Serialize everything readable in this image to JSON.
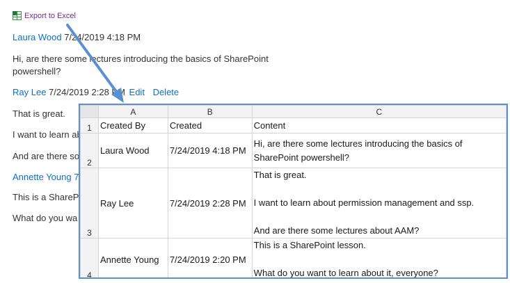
{
  "export_link": {
    "label": "Export to Excel",
    "icon": "excel-icon"
  },
  "posts": [
    {
      "author": "Laura Wood",
      "timestamp": "7/24/2019 4:18 PM",
      "lines": [
        "Hi, are there some lectures introducing the basics of SharePoint",
        "powershell?"
      ]
    },
    {
      "author": "Ray Lee",
      "timestamp": "7/24/2019 2:28 PM",
      "edit_label": "Edit",
      "delete_label": "Delete",
      "lines": [
        "That is great.",
        "I want to learn ab",
        "And are there so"
      ]
    },
    {
      "author": "Annette Young",
      "timestamp_partial": "7",
      "lines": [
        "This is a SharePo",
        "What do you wa"
      ]
    }
  ],
  "excel": {
    "columns": [
      "A",
      "B",
      "C"
    ],
    "row_numbers": [
      "1",
      "2",
      "3",
      "4"
    ],
    "header_row": [
      "Created By",
      "Created",
      "Content"
    ],
    "rows": [
      {
        "created_by": "Laura Wood",
        "created": "7/24/2019 4:18 PM",
        "content": "Hi, are there some lectures introducing the basics of\nSharePoint powershell?"
      },
      {
        "created_by": "Ray Lee",
        "created": "7/24/2019 2:28 PM",
        "content": "That is great.\n\nI want to learn about permission management and ssp.\n\nAnd are there some lectures about AAM?"
      },
      {
        "created_by": "Annette Young",
        "created": "7/24/2019 2:20 PM",
        "content": "This is a SharePoint lesson.\n\nWhat do you want to learn about it, everyone?"
      }
    ]
  },
  "colors": {
    "link": "#0f6fc6",
    "arrow": "#5b8fd1",
    "export_link": "#6a2b8f"
  }
}
